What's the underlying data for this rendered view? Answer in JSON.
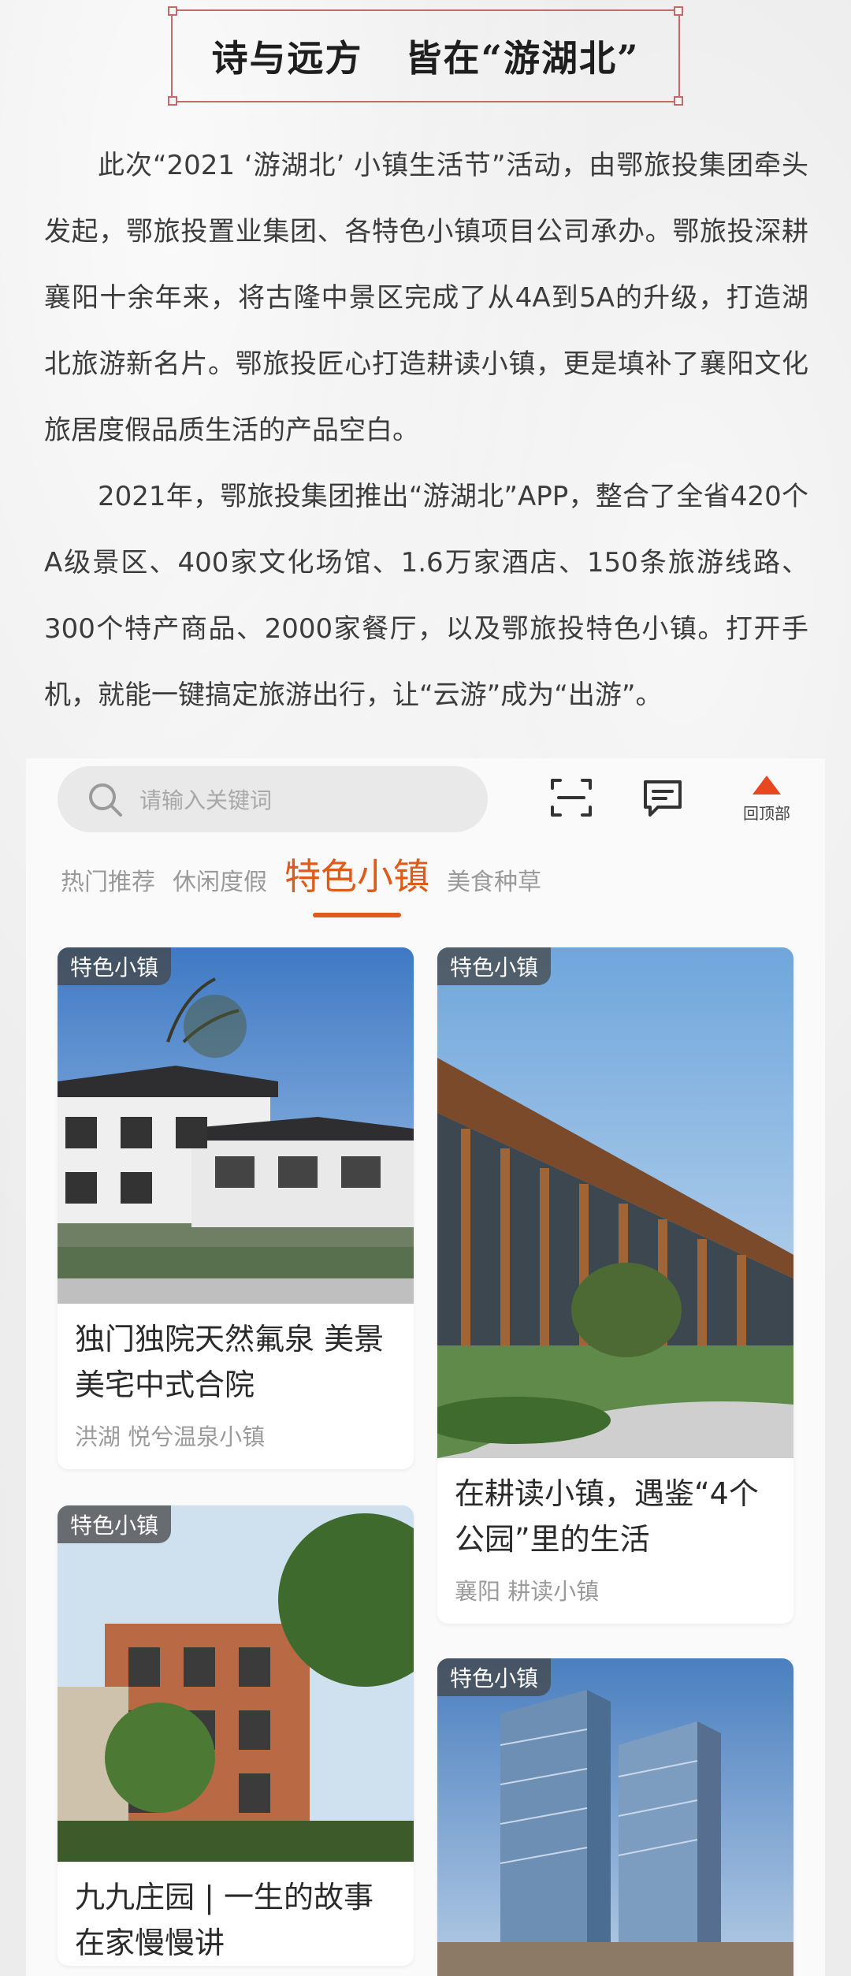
{
  "header": {
    "title": "诗与远方   皆在“游湖北”"
  },
  "article": {
    "paragraphs": [
      "此次“2021 ‘游湖北’ 小镇生活节”活动，由鄂旅投集团牵头发起，鄂旅投置业集团、各特色小镇项目公司承办。鄂旅投深耕襄阳十余年来，将古隆中景区完成了从4A到5A的升级，打造湖北旅游新名片。鄂旅投匠心打造耕读小镇，更是填补了襄阳文化旅居度假品质生活的产品空白。",
      "2021年，鄂旅投集团推出“游湖北”APP，整合了全省420个A级景区、400家文化场馆、1.6万家酒店、150条旅游线路、300个特产商品、2000家餐厅，以及鄂旅投特色小镇。打开手机，就能一键搞定旅游出行，让“云游”成为“出游”。"
    ]
  },
  "app": {
    "search": {
      "placeholder": "请输入关键词",
      "icon": "search-icon"
    },
    "scan_icon": "scan-icon",
    "message_icon": "message-icon",
    "top_button": {
      "label": "回顶部",
      "icon": "up-arrow-icon",
      "color": "#e8481f"
    },
    "accent_color": "#e05a1c",
    "tabs": [
      {
        "label": "热门推荐",
        "active": false
      },
      {
        "label": "休闲度假",
        "active": false
      },
      {
        "label": "特色小镇",
        "active": true
      },
      {
        "label": "美食种草",
        "active": false
      }
    ],
    "cards": [
      {
        "badge": "特色小镇",
        "title": "独门独院天然氟泉 美景美宅中式合院",
        "location": "洪湖 悦兮温泉小镇"
      },
      {
        "badge": "特色小镇",
        "title": "在耕读小镇，遇鉴“4个公园”里的生活",
        "location": "襄阳 耕读小镇"
      },
      {
        "badge": "特色小镇",
        "title": "九九庄园 | 一生的故事 在家慢慢讲",
        "location": ""
      },
      {
        "badge": "特色小镇",
        "title": "",
        "location": ""
      }
    ]
  }
}
